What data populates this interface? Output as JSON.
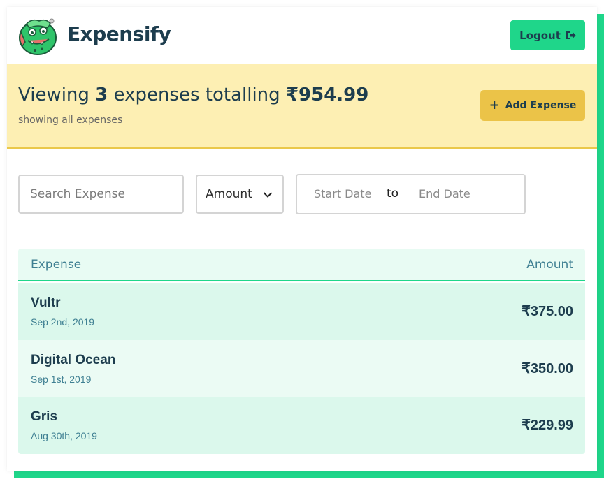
{
  "header": {
    "brand": "Expensify",
    "logout_label": "Logout"
  },
  "summary": {
    "prefix": "Viewing ",
    "count": "3",
    "middle": " expenses totalling ",
    "total": "₹954.99",
    "subtitle": "showing all expenses",
    "add_label": "Add Expense"
  },
  "filters": {
    "search_placeholder": "Search Expense",
    "sort_value": "Amount",
    "start_date_placeholder": "Start Date",
    "separator": "to",
    "end_date_placeholder": "End Date"
  },
  "table": {
    "col_expense": "Expense",
    "col_amount": "Amount",
    "rows": [
      {
        "name": "Vultr",
        "date": "Sep 2nd, 2019",
        "amount": "₹375.00"
      },
      {
        "name": "Digital Ocean",
        "date": "Sep 1st, 2019",
        "amount": "₹350.00"
      },
      {
        "name": "Gris",
        "date": "Aug 30th, 2019",
        "amount": "₹229.99"
      }
    ]
  },
  "colors": {
    "accent_green": "#1fd68a",
    "brand_navy": "#1d3d4e",
    "summary_bg": "#fdefb3",
    "add_button": "#ebc348"
  },
  "icons": {
    "logo": "dragon-mascot-icon",
    "logout": "sign-out-icon",
    "add": "plus-icon",
    "dropdown": "chevron-down-icon"
  }
}
